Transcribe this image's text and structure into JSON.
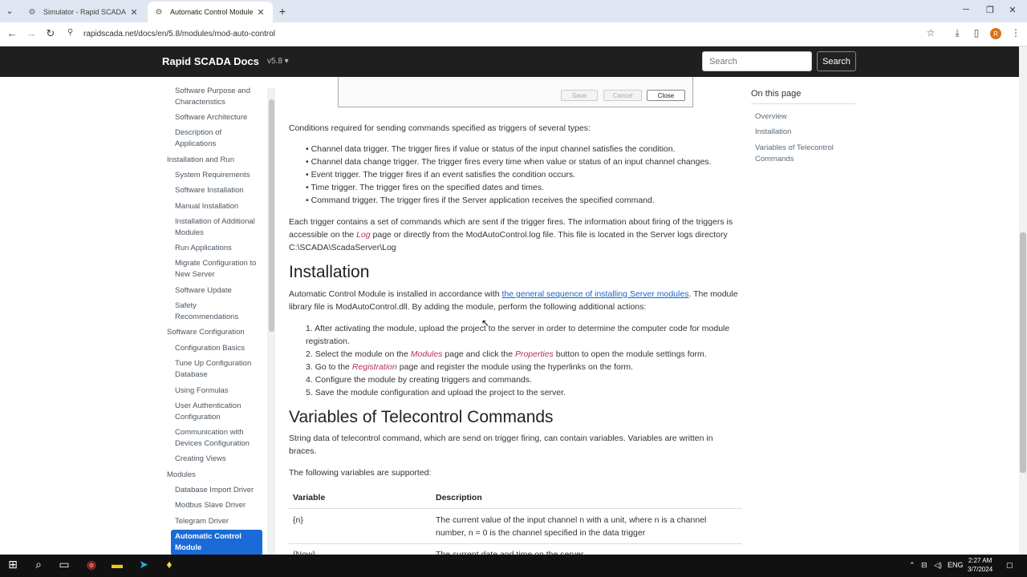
{
  "browser": {
    "tabs": [
      {
        "label": "Simulator - Rapid SCADA"
      },
      {
        "label": "Automatic Control Module - Ra"
      }
    ],
    "url": "rapidscada.net/docs/en/5.8/modules/mod-auto-control",
    "profile_initial": "R"
  },
  "site": {
    "brand": "Rapid SCADA Docs",
    "version": "v5.8",
    "search_placeholder": "Search",
    "search_button": "Search"
  },
  "sidebar": {
    "items": [
      "Software Purpose and Characteristics",
      "Software Architecture",
      "Description of Applications",
      "Installation and Run",
      "System Requirements",
      "Software Installation",
      "Manual Installation",
      "Installation of Additional Modules",
      "Run Applications",
      "Migrate Configuration to New Server",
      "Software Update",
      "Safety Recommendations",
      "Software Configuration",
      "Configuration Basics",
      "Tune Up Configuration Database",
      "Using Formulas",
      "User Authentication Configuration",
      "Communication with Devices Configuration",
      "Creating Views",
      "Modules",
      "Database Import Driver",
      "Modbus Slave Driver",
      "Telegram Driver",
      "Automatic Control Module"
    ]
  },
  "dialog": {
    "save": "Save",
    "cancel": "Cancel",
    "close": "Close"
  },
  "content": {
    "intro": "Conditions required for sending commands specified as triggers of several types:",
    "triggers": [
      "Channel data trigger. The trigger fires if value or status of the input channel satisfies the condition.",
      "Channel data change trigger. The trigger fires every time when value or status of an input channel changes.",
      "Event trigger. The trigger fires if an event satisfies the condition occurs.",
      "Time trigger. The trigger fires on the specified dates and times.",
      "Command trigger. The trigger fires if the Server application receives the specified command."
    ],
    "para2_a": "Each trigger contains a set of commands which are sent if the trigger fires. The information about firing of the triggers is accessible on the ",
    "para2_em": "Log",
    "para2_b": " page or directly from the ModAutoControl.log file. This file is located in the Server logs directory C:\\SCADA\\ScadaServer\\Log",
    "h_installation": "Installation",
    "inst_a": "Automatic Control Module is installed in accordance with ",
    "inst_link": "the general sequence of installing Server modules",
    "inst_b": ". The module library file is ModAutoControl.dll. By adding the module, perform the following additional actions:",
    "step1": "After activating the module, upload the project to the server in order to determine the computer code for module registration.",
    "step2_a": "Select the module on the ",
    "step2_em1": "Modules",
    "step2_b": " page and click the ",
    "step2_em2": "Properties",
    "step2_c": " button to open the module settings form.",
    "step3_a": "Go to the ",
    "step3_em": "Registration",
    "step3_b": " page and register the module using the hyperlinks on the form.",
    "step4": "Configure the module by creating triggers and commands.",
    "step5": "Save the module configuration and upload the project to the server.",
    "h_variables": "Variables of Telecontrol Commands",
    "var_para": "String data of telecontrol command, which are send on trigger firing, can contain variables. Variables are written in braces.",
    "var_supported": "The following variables are supported:",
    "table": {
      "headers": [
        "Variable",
        "Description"
      ],
      "rows": [
        [
          "{n}",
          "The current value of the input channel n with a unit, where n is a channel number, n = 0 is the channel specified in the data trigger"
        ],
        [
          "{Now}",
          "The current date and time on the server"
        ]
      ]
    }
  },
  "toc": {
    "title": "On this page",
    "items": [
      "Overview",
      "Installation",
      "Variables of Telecontrol Commands"
    ]
  },
  "taskbar": {
    "lang": "ENG",
    "time": "2:27 AM",
    "date": "3/7/2024"
  }
}
